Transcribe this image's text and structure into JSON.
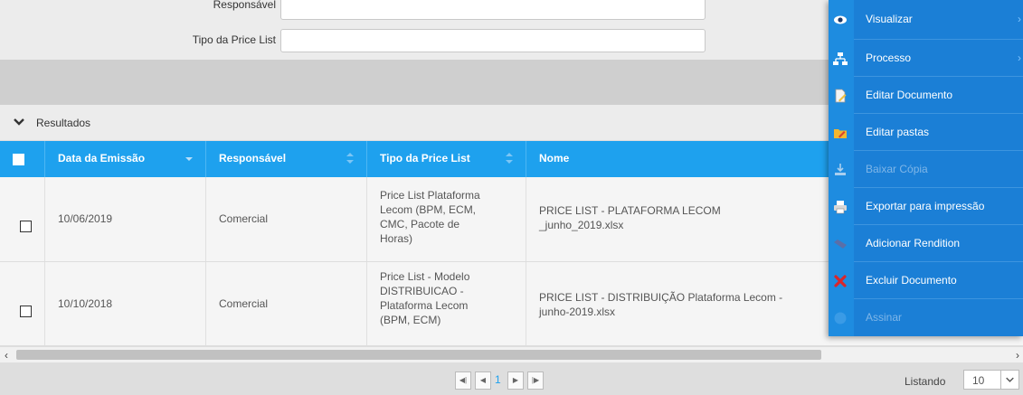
{
  "filters": {
    "responsavel_label": "Responsável",
    "tipo_label": "Tipo da Price List",
    "responsavel_value": "",
    "tipo_value": ""
  },
  "results": {
    "title": "Resultados"
  },
  "table": {
    "columns": [
      "Data da Emissão",
      "Responsável",
      "Tipo da Price List",
      "Nome"
    ],
    "rows": [
      {
        "date": "10/06/2019",
        "responsavel": "Comercial",
        "tipo": [
          "Price List Plataforma",
          "Lecom (BPM, ECM,",
          "CMC, Pacote de",
          "Horas)"
        ],
        "nome": [
          "PRICE LIST - PLATAFORMA LECOM",
          "_junho_2019.xlsx"
        ]
      },
      {
        "date": "10/10/2018",
        "responsavel": "Comercial",
        "tipo": [
          "Price List - Modelo",
          "DISTRIBUICAO -",
          "Plataforma Lecom",
          "(BPM, ECM)"
        ],
        "nome": [
          "PRICE LIST - DISTRIBUIÇÃO Plataforma Lecom -",
          "junho-2019.xlsx"
        ]
      }
    ]
  },
  "pagination": {
    "current_page": "1",
    "listing_label": "Listando",
    "page_size": "10"
  },
  "menu": {
    "items": [
      {
        "label": "Visualizar",
        "icon": "eye-icon",
        "disabled": false,
        "submenu": true
      },
      {
        "label": "Processo",
        "icon": "process-icon",
        "disabled": false,
        "submenu": true
      },
      {
        "label": "Editar Documento",
        "icon": "document-edit-icon",
        "disabled": false,
        "submenu": false
      },
      {
        "label": "Editar pastas",
        "icon": "folder-icon",
        "disabled": false,
        "submenu": false
      },
      {
        "label": "Baixar Cópia",
        "icon": "download-icon",
        "disabled": true,
        "submenu": false
      },
      {
        "label": "Exportar para impressão",
        "icon": "printer-icon",
        "disabled": false,
        "submenu": false
      },
      {
        "label": "Adicionar Rendition",
        "icon": "rendition-icon",
        "disabled": false,
        "submenu": false
      },
      {
        "label": "Excluir Documento",
        "icon": "delete-x-icon",
        "disabled": false,
        "submenu": false
      },
      {
        "label": "Assinar",
        "icon": "sign-dot-icon",
        "disabled": true,
        "submenu": false
      }
    ]
  },
  "colors": {
    "header_blue": "#1ea1ee",
    "menu_blue": "#1b7fd6",
    "delete_red": "#d9262b"
  }
}
